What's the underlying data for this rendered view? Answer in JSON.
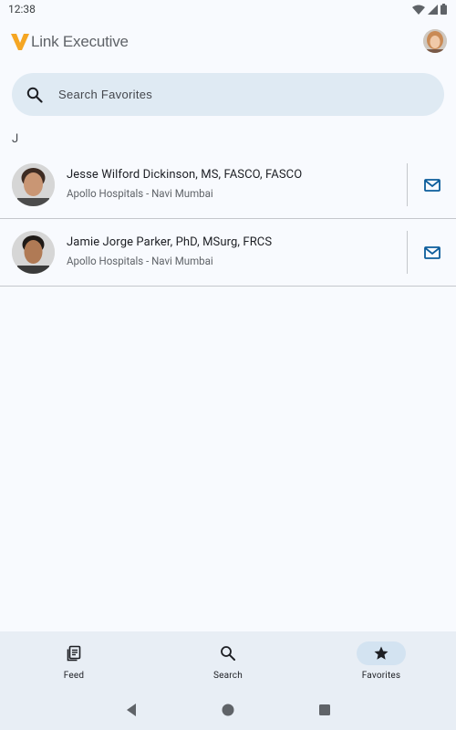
{
  "status_bar": {
    "time": "12:38"
  },
  "header": {
    "logo_text": "Link Executive"
  },
  "search": {
    "placeholder": "Search Favorites",
    "value": ""
  },
  "section": {
    "letter": "J"
  },
  "contacts": [
    {
      "name": "Jesse Wilford Dickinson, MS, FASCO, FASCO",
      "org": "Apollo Hospitals - Navi Mumbai"
    },
    {
      "name": "Jamie Jorge Parker, PhD, MSurg, FRCS",
      "org": "Apollo Hospitals - Navi Mumbai"
    }
  ],
  "bottom_nav": [
    {
      "label": "Feed",
      "icon": "feed-icon"
    },
    {
      "label": "Search",
      "icon": "search-icon"
    },
    {
      "label": "Favorites",
      "icon": "star-icon",
      "active": true
    }
  ],
  "colors": {
    "brand_orange": "#f5a623",
    "accent": "#0b5c9b",
    "nav_bg": "#e8eef5"
  }
}
